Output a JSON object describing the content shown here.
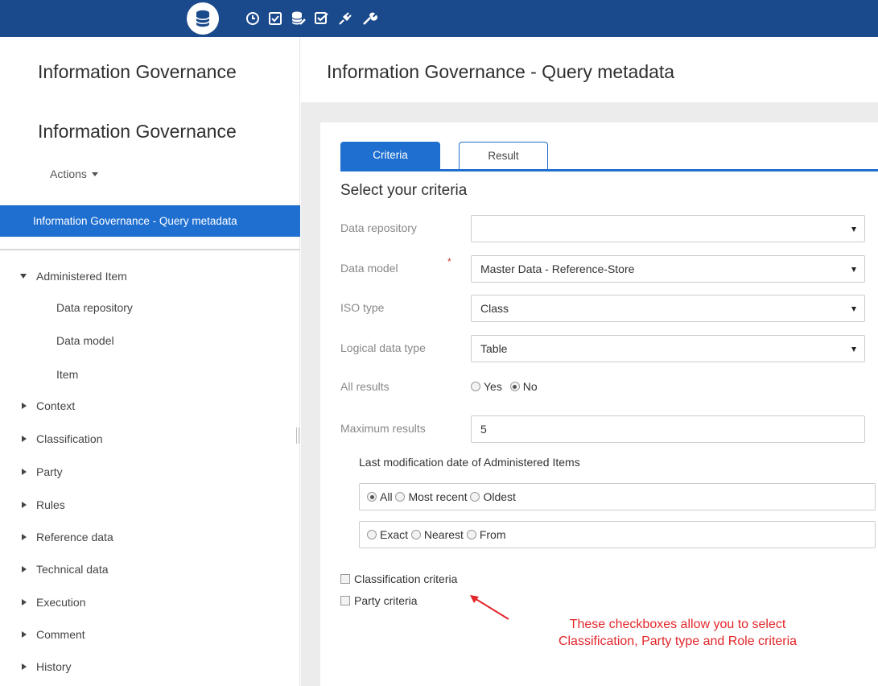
{
  "topbar": {
    "icons": [
      "database-icon",
      "clock-icon",
      "checked-box-icon",
      "database-edit-icon",
      "task-check-icon",
      "plug-icon",
      "wrench-icon"
    ],
    "active_icon": "database-icon",
    "color": "#1b4a8c"
  },
  "sidebar": {
    "title": "Information Governance",
    "subtitle": "Information Governance",
    "actions_label": "Actions",
    "selected_item": "Information Governance - Query metadata",
    "tree": [
      {
        "label": "Administered Item",
        "expanded": true,
        "children": [
          "Data repository",
          "Data model",
          "Item"
        ]
      },
      {
        "label": "Context",
        "expanded": false
      },
      {
        "label": "Classification",
        "expanded": false
      },
      {
        "label": "Party",
        "expanded": false
      },
      {
        "label": "Rules",
        "expanded": false
      },
      {
        "label": "Reference data",
        "expanded": false
      },
      {
        "label": "Technical data",
        "expanded": false
      },
      {
        "label": "Execution",
        "expanded": false
      },
      {
        "label": "Comment",
        "expanded": false
      },
      {
        "label": "History",
        "expanded": false
      }
    ]
  },
  "main": {
    "page_title": "Information Governance - Query metadata",
    "tabs": [
      {
        "label": "Criteria",
        "active": true
      },
      {
        "label": "Result",
        "active": false
      }
    ],
    "section_title": "Select your criteria",
    "fields": {
      "data_repository": {
        "label": "Data repository",
        "value": ""
      },
      "data_model": {
        "label": "Data model",
        "required_mark": "*",
        "value": "Master Data - Reference-Store"
      },
      "iso_type": {
        "label": "ISO type",
        "value": "Class"
      },
      "logical_data_type": {
        "label": "Logical data type",
        "value": "Table"
      },
      "all_results": {
        "label": "All results",
        "options": [
          "Yes",
          "No"
        ],
        "selected": "No"
      },
      "maximum_results": {
        "label": "Maximum results",
        "value": "5"
      }
    },
    "last_modification": {
      "label": "Last modification date of Administered Items",
      "group1": {
        "options": [
          "All",
          "Most recent",
          "Oldest"
        ],
        "selected": "All"
      },
      "group2": {
        "options": [
          "Exact",
          "Nearest",
          "From"
        ],
        "selected": ""
      }
    },
    "checkboxes": [
      {
        "label": "Classification criteria",
        "checked": false
      },
      {
        "label": "Party criteria",
        "checked": false
      }
    ]
  },
  "annotation": {
    "line1": "These checkboxes allow you to select",
    "line2": "Classification, Party type and Role criteria",
    "color": "#e3262a"
  },
  "colors": {
    "accent": "#1e6fd0",
    "topbar": "#1b4a8c"
  }
}
